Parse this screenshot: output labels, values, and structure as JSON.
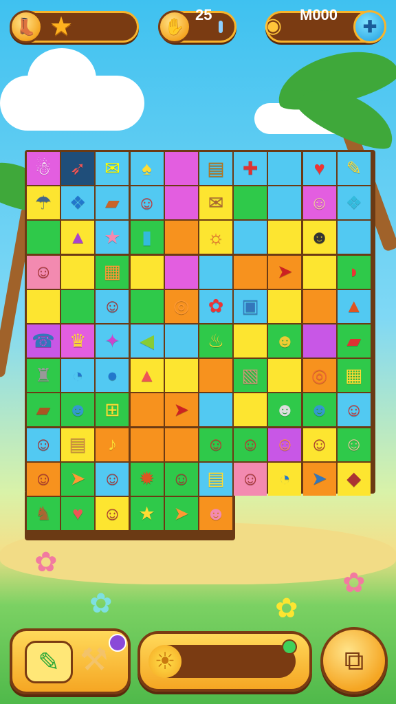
{
  "hud": {
    "profile_icon": "boot-icon",
    "star_icon": "star-icon",
    "moves_value": "25",
    "coins_value": "M000",
    "moves_icon": "hand-icon",
    "coins_icon": "coin-stack-icon",
    "add_icon": "plus-icon"
  },
  "colors": {
    "magenta": "#e35ee0",
    "navy": "#1f4e7a",
    "cyan": "#52c9f2",
    "yellow": "#fde530",
    "green": "#2fc94a",
    "orange": "#f7921e",
    "pink": "#f38ab0",
    "purple": "#c857e6"
  },
  "board": {
    "rows": [
      [
        {
          "c": "magenta",
          "g": "☃",
          "col": "#fff"
        },
        {
          "c": "navy",
          "g": "➶",
          "col": "#e55"
        },
        {
          "c": "cyan",
          "g": "✉",
          "col": "#ff0"
        },
        {
          "c": "cyan",
          "g": "♠",
          "col": "#fd3"
        },
        {
          "c": "magenta",
          "g": "",
          "col": "#000"
        },
        {
          "c": "cyan",
          "g": "▤",
          "col": "#b8741a"
        },
        {
          "c": "cyan",
          "g": "✚",
          "col": "#d33"
        },
        {
          "c": "cyan",
          "g": "",
          "col": "#000"
        },
        {
          "c": "cyan",
          "g": "♥",
          "col": "#e33"
        },
        {
          "c": "cyan",
          "g": "✎",
          "col": "#fd3"
        }
      ],
      [
        {
          "c": "yellow",
          "g": "☂",
          "col": "#468"
        },
        {
          "c": "cyan",
          "g": "❖",
          "col": "#27c"
        },
        {
          "c": "cyan",
          "g": "▰",
          "col": "#c7642a"
        },
        {
          "c": "cyan",
          "g": "☺",
          "col": "#c33"
        },
        {
          "c": "magenta",
          "g": "",
          "col": "#000"
        },
        {
          "c": "yellow",
          "g": "✉",
          "col": "#a63"
        },
        {
          "c": "green",
          "g": "",
          "col": "#000"
        },
        {
          "c": "cyan",
          "g": "",
          "col": "#000"
        },
        {
          "c": "magenta",
          "g": "☺",
          "col": "#f2c8a0"
        },
        {
          "c": "cyan",
          "g": "❖",
          "col": "#3bd"
        }
      ],
      [
        {
          "c": "green",
          "g": "",
          "col": "#000"
        },
        {
          "c": "yellow",
          "g": "▲",
          "col": "#a4c"
        },
        {
          "c": "cyan",
          "g": "★",
          "col": "#f38ab0"
        },
        {
          "c": "green",
          "g": "▮",
          "col": "#3bd"
        },
        {
          "c": "orange",
          "g": "",
          "col": "#000"
        },
        {
          "c": "yellow",
          "g": "☼",
          "col": "#e63"
        },
        {
          "c": "cyan",
          "g": "",
          "col": "#000"
        },
        {
          "c": "yellow",
          "g": "",
          "col": "#000"
        },
        {
          "c": "yellow",
          "g": "☻",
          "col": "#333"
        },
        {
          "c": "cyan",
          "g": "",
          "col": "#000"
        }
      ],
      [
        {
          "c": "pink",
          "g": "☺",
          "col": "#a33"
        },
        {
          "c": "yellow",
          "g": "",
          "col": "#000"
        },
        {
          "c": "green",
          "g": "▦",
          "col": "#f93"
        },
        {
          "c": "yellow",
          "g": "",
          "col": "#000"
        },
        {
          "c": "magenta",
          "g": "",
          "col": "#000"
        },
        {
          "c": "cyan",
          "g": "",
          "col": "#000"
        },
        {
          "c": "orange",
          "g": "",
          "col": "#000"
        },
        {
          "c": "orange",
          "g": "➤",
          "col": "#c22"
        },
        {
          "c": "yellow",
          "g": "",
          "col": "#000"
        },
        {
          "c": "green",
          "g": "◗",
          "col": "#e33"
        }
      ],
      [
        {
          "c": "yellow",
          "g": "",
          "col": "#000"
        },
        {
          "c": "green",
          "g": "",
          "col": "#000"
        },
        {
          "c": "cyan",
          "g": "☺",
          "col": "#a33"
        },
        {
          "c": "green",
          "g": "",
          "col": "#000"
        },
        {
          "c": "orange",
          "g": "◎",
          "col": "#f93"
        },
        {
          "c": "cyan",
          "g": "✿",
          "col": "#e33"
        },
        {
          "c": "cyan",
          "g": "▣",
          "col": "#37b"
        },
        {
          "c": "yellow",
          "g": "",
          "col": "#000"
        },
        {
          "c": "orange",
          "g": "",
          "col": "#000"
        },
        {
          "c": "cyan",
          "g": "▲",
          "col": "#d52"
        }
      ],
      [
        {
          "c": "purple",
          "g": "☎",
          "col": "#37b"
        },
        {
          "c": "magenta",
          "g": "♛",
          "col": "#fd3"
        },
        {
          "c": "cyan",
          "g": "✦",
          "col": "#c4c"
        },
        {
          "c": "cyan",
          "g": "◀",
          "col": "#8c3"
        },
        {
          "c": "cyan",
          "g": "",
          "col": "#000"
        },
        {
          "c": "green",
          "g": "♨",
          "col": "#fd3"
        },
        {
          "c": "yellow",
          "g": "",
          "col": "#000"
        },
        {
          "c": "green",
          "g": "☻",
          "col": "#ec3"
        },
        {
          "c": "purple",
          "g": "",
          "col": "#000"
        },
        {
          "c": "green",
          "g": "▰",
          "col": "#d33"
        }
      ],
      [
        {
          "c": "green",
          "g": "♜",
          "col": "#999"
        },
        {
          "c": "cyan",
          "g": "◔",
          "col": "#27c"
        },
        {
          "c": "cyan",
          "g": "●",
          "col": "#27c"
        },
        {
          "c": "yellow",
          "g": "▲",
          "col": "#e55"
        },
        {
          "c": "yellow",
          "g": "",
          "col": "#000"
        },
        {
          "c": "orange",
          "g": "",
          "col": "#000"
        },
        {
          "c": "green",
          "g": "▧",
          "col": "#c97"
        },
        {
          "c": "yellow",
          "g": "",
          "col": "#000"
        },
        {
          "c": "orange",
          "g": "◎",
          "col": "#e63"
        },
        {
          "c": "green",
          "g": "▦",
          "col": "#fd3"
        }
      ],
      [
        {
          "c": "green",
          "g": "▰",
          "col": "#a52"
        },
        {
          "c": "green",
          "g": "☻",
          "col": "#39c"
        },
        {
          "c": "green",
          "g": "⊞",
          "col": "#fd3"
        },
        {
          "c": "orange",
          "g": "",
          "col": "#000"
        },
        {
          "c": "orange",
          "g": "➤",
          "col": "#c22"
        },
        {
          "c": "cyan",
          "g": "",
          "col": "#000"
        },
        {
          "c": "yellow",
          "g": "",
          "col": "#000"
        },
        {
          "c": "green",
          "g": "☻",
          "col": "#ddd"
        },
        {
          "c": "green",
          "g": "☻",
          "col": "#39c"
        },
        {
          "c": "cyan",
          "g": "☺",
          "col": "#c33"
        }
      ],
      [
        {
          "c": "cyan",
          "g": "☺",
          "col": "#a33"
        },
        {
          "c": "yellow",
          "g": "▤",
          "col": "#c84"
        },
        {
          "c": "orange",
          "g": "♪",
          "col": "#fd3"
        },
        {
          "c": "orange",
          "g": "",
          "col": "#000"
        },
        {
          "c": "orange",
          "g": "",
          "col": "#000"
        },
        {
          "c": "green",
          "g": "☺",
          "col": "#c33"
        },
        {
          "c": "green",
          "g": "☺",
          "col": "#c33"
        },
        {
          "c": "purple",
          "g": "☺",
          "col": "#f93"
        },
        {
          "c": "yellow",
          "g": "☺",
          "col": "#a33"
        },
        {
          "c": "green",
          "g": "☺",
          "col": "#f2c8a0"
        }
      ],
      [
        {
          "c": "orange",
          "g": "☺",
          "col": "#a33"
        },
        {
          "c": "green",
          "g": "➤",
          "col": "#f93"
        },
        {
          "c": "cyan",
          "g": "☺",
          "col": "#a33"
        },
        {
          "c": "green",
          "g": "✹",
          "col": "#d52"
        },
        {
          "c": "green",
          "g": "☺",
          "col": "#a33"
        },
        {
          "c": "cyan",
          "g": "▤",
          "col": "#fd3"
        },
        {
          "c": "pink",
          "g": "☺",
          "col": "#a33"
        },
        {
          "c": "yellow",
          "g": "◔",
          "col": "#27c"
        },
        {
          "c": "orange",
          "g": "➤",
          "col": "#37b"
        },
        {
          "c": "yellow",
          "g": "◆",
          "col": "#a33"
        }
      ],
      [
        {
          "c": "green",
          "g": "♞",
          "col": "#a63"
        },
        {
          "c": "green",
          "g": "♥",
          "col": "#e55"
        },
        {
          "c": "yellow",
          "g": "☺",
          "col": "#a33"
        },
        {
          "c": "green",
          "g": "★",
          "col": "#fd3"
        },
        {
          "c": "green",
          "g": "➤",
          "col": "#f93"
        },
        {
          "c": "orange",
          "g": "☻",
          "col": "#f38ab0"
        }
      ]
    ]
  },
  "bottom": {
    "brush_icon": "paint-brush-icon",
    "hammer_icon": "hammer-icon",
    "sun_icon": "sun-icon",
    "progress": 0.12,
    "exit_icon": "exit-door-icon"
  }
}
